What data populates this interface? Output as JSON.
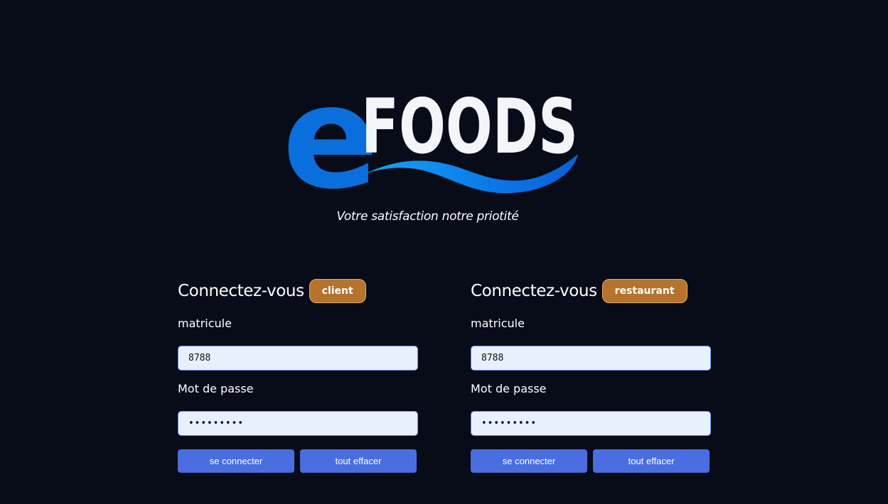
{
  "logo": {
    "text_e": "e",
    "text_foods": "FOODS",
    "color_e": "#0a6fdc",
    "color_text": "#f3f5f8",
    "wave_color": "#0d8cf2"
  },
  "tagline": "Votre satisfaction  notre priotité",
  "forms": {
    "client": {
      "title": "Connectez-vous",
      "badge": "client",
      "matricule_label": "matricule",
      "matricule_value": "8788",
      "password_label": "Mot de passe",
      "password_value": "123456789",
      "connect_label": "se connecter",
      "clear_label": "tout effacer"
    },
    "restaurant": {
      "title": "Connectez-vous",
      "badge": "restaurant",
      "matricule_label": "matricule",
      "matricule_value": "8788",
      "password_label": "Mot de passe",
      "password_value": "123456789",
      "connect_label": "se connecter",
      "clear_label": "tout effacer"
    }
  },
  "colors": {
    "background": "#080c19",
    "badge": "#b5732d",
    "button": "#4a6ee0",
    "input_bg": "#e8f0fe"
  }
}
